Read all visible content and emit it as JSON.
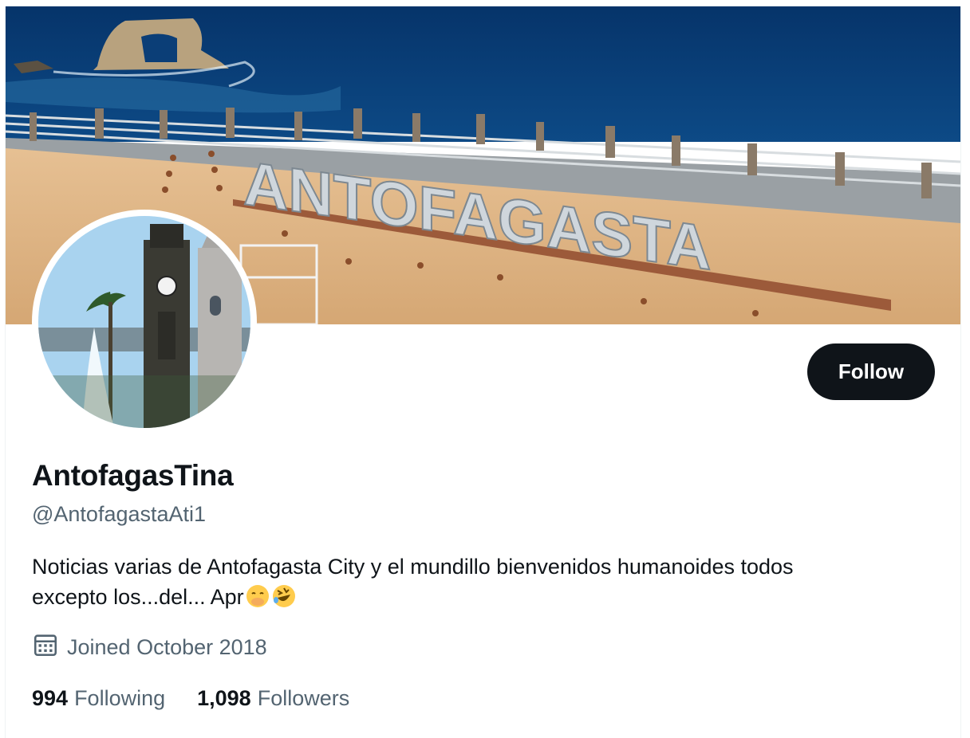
{
  "profile": {
    "display_name": "AntofagasTina",
    "handle": "@AntofagastaAti1",
    "bio_line1": "Noticias varias de Antofagasta City y el mundillo bienvenidos humanoides todos",
    "bio_line2": "excepto los...del... Apr",
    "joined": "Joined October 2018",
    "follow_label": "Follow"
  },
  "banner": {
    "sign_text": "ANTOFAGASTA",
    "icon": "antofagasta-sign-photo"
  },
  "avatar": {
    "icon": "clock-tower-photo"
  },
  "stats": {
    "following_count": "994",
    "following_label": "Following",
    "followers_count": "1,098",
    "followers_label": "Followers"
  },
  "colors": {
    "text_primary": "#0f1419",
    "text_secondary": "#536471",
    "button_bg": "#0f1419",
    "button_text": "#ffffff",
    "sea": "#0d3f78",
    "sand": "#dcb483"
  }
}
